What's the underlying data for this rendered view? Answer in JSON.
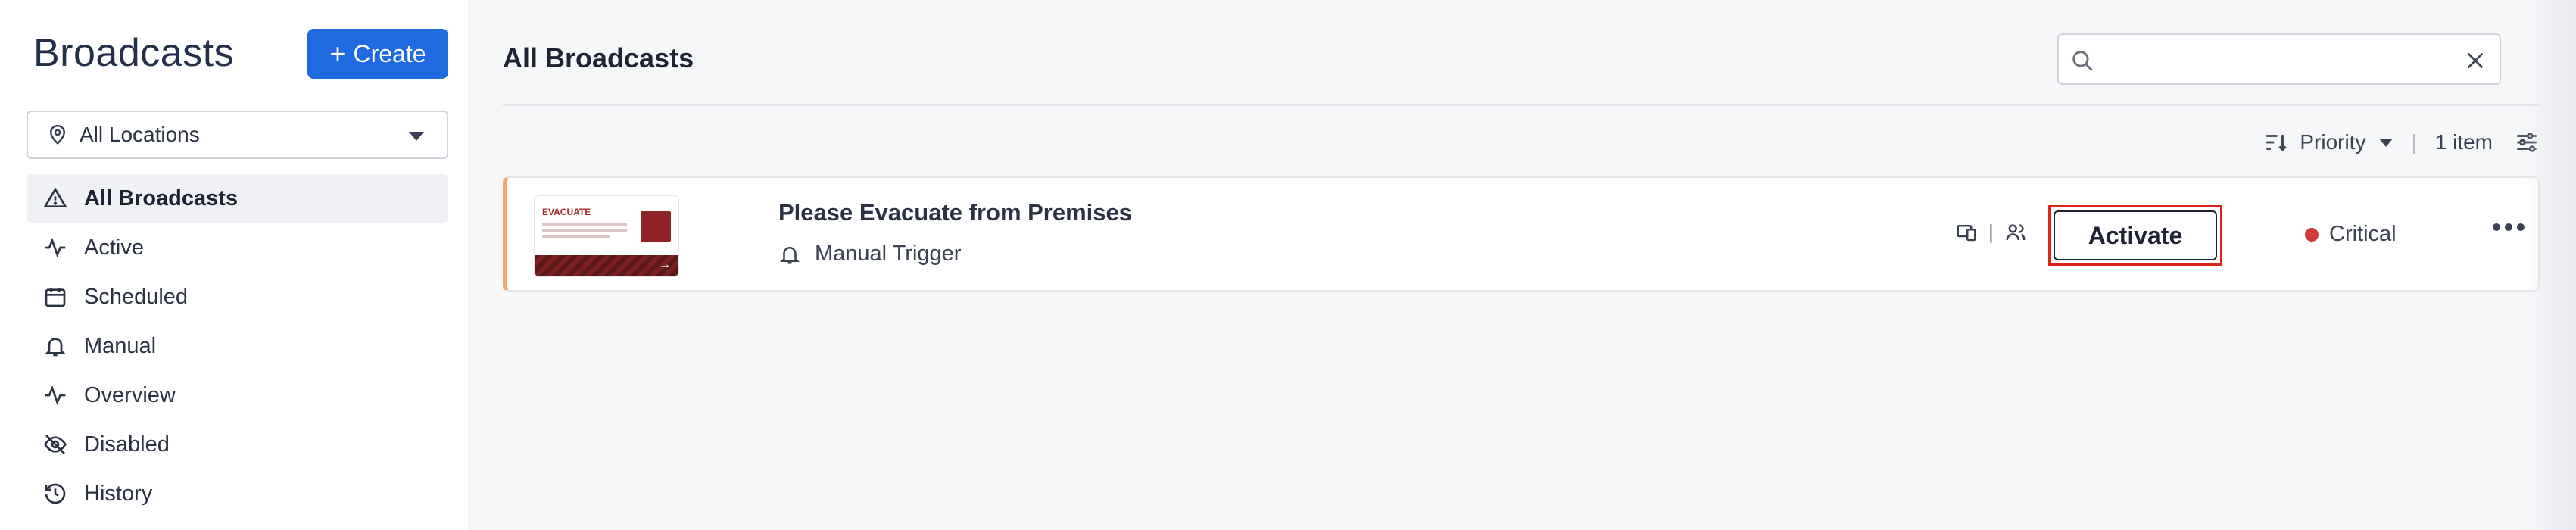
{
  "sidebar": {
    "title": "Broadcasts",
    "create_label": "Create",
    "location_select": {
      "value": "All Locations"
    },
    "items": [
      {
        "label": "All Broadcasts",
        "icon": "alert-triangle-icon",
        "active": true
      },
      {
        "label": "Active",
        "icon": "activity-icon",
        "active": false
      },
      {
        "label": "Scheduled",
        "icon": "calendar-icon",
        "active": false
      },
      {
        "label": "Manual",
        "icon": "bell-icon",
        "active": false
      },
      {
        "label": "Overview",
        "icon": "activity-icon",
        "active": false
      },
      {
        "label": "Disabled",
        "icon": "eye-off-icon",
        "active": false
      },
      {
        "label": "History",
        "icon": "history-icon",
        "active": false
      }
    ]
  },
  "main": {
    "title": "All Broadcasts",
    "search": {
      "value": "",
      "placeholder": ""
    },
    "toolbar": {
      "sort_label": "Priority",
      "count_label": "1 item"
    },
    "broadcasts": [
      {
        "title": "Please Evacuate from Premises",
        "trigger": "Manual Trigger",
        "thumbnail_title": "EVACUATE",
        "action_label": "Activate",
        "priority": "Critical",
        "priority_color": "#cc3a3a",
        "accent_color": "#f0a96b"
      }
    ]
  },
  "colors": {
    "primary": "#1f6ae0",
    "highlight": "#e0241b"
  }
}
